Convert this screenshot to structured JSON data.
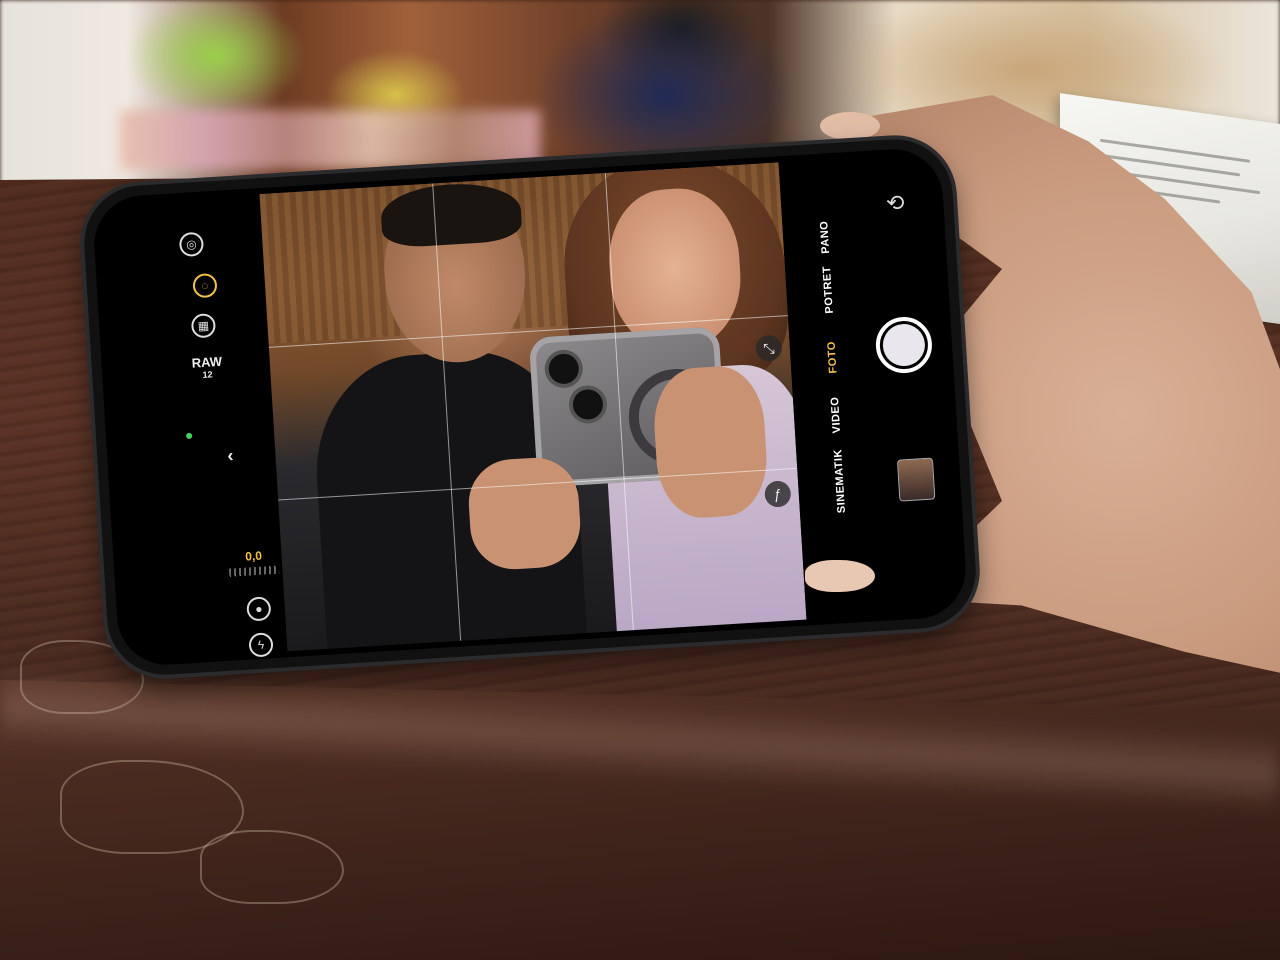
{
  "scene": {
    "description_role": "photo",
    "colors": {
      "wood": "#4f2b1e",
      "skin": "#c99a7e",
      "accent_mode": "#f2c14b",
      "phone_body": "#111111"
    }
  },
  "camera_ui": {
    "raw_label": "RAW",
    "raw_sub": "12",
    "exposure_value": "0,0",
    "modes": [
      {
        "label": "SINEMATIK",
        "active": false
      },
      {
        "label": "VIDEO",
        "active": false
      },
      {
        "label": "FOTO",
        "active": true
      },
      {
        "label": "POTRET",
        "active": false
      },
      {
        "label": "PANO",
        "active": false
      }
    ],
    "icons": {
      "live": "live-photo-icon",
      "night": "night-mode-icon",
      "styles": "photographic-styles-icon",
      "back": "chevron-left-icon",
      "timer": "record-icon",
      "flash": "flash-icon",
      "flip": "camera-flip-icon",
      "zoom": "zoom-collapse-icon",
      "aperture": "aperture-f-icon"
    },
    "aperture_symbol": "ƒ",
    "collapse_symbol": "⤡",
    "flip_symbol": "⟲",
    "back_symbol": "‹",
    "flash_symbol": "ϟ"
  }
}
